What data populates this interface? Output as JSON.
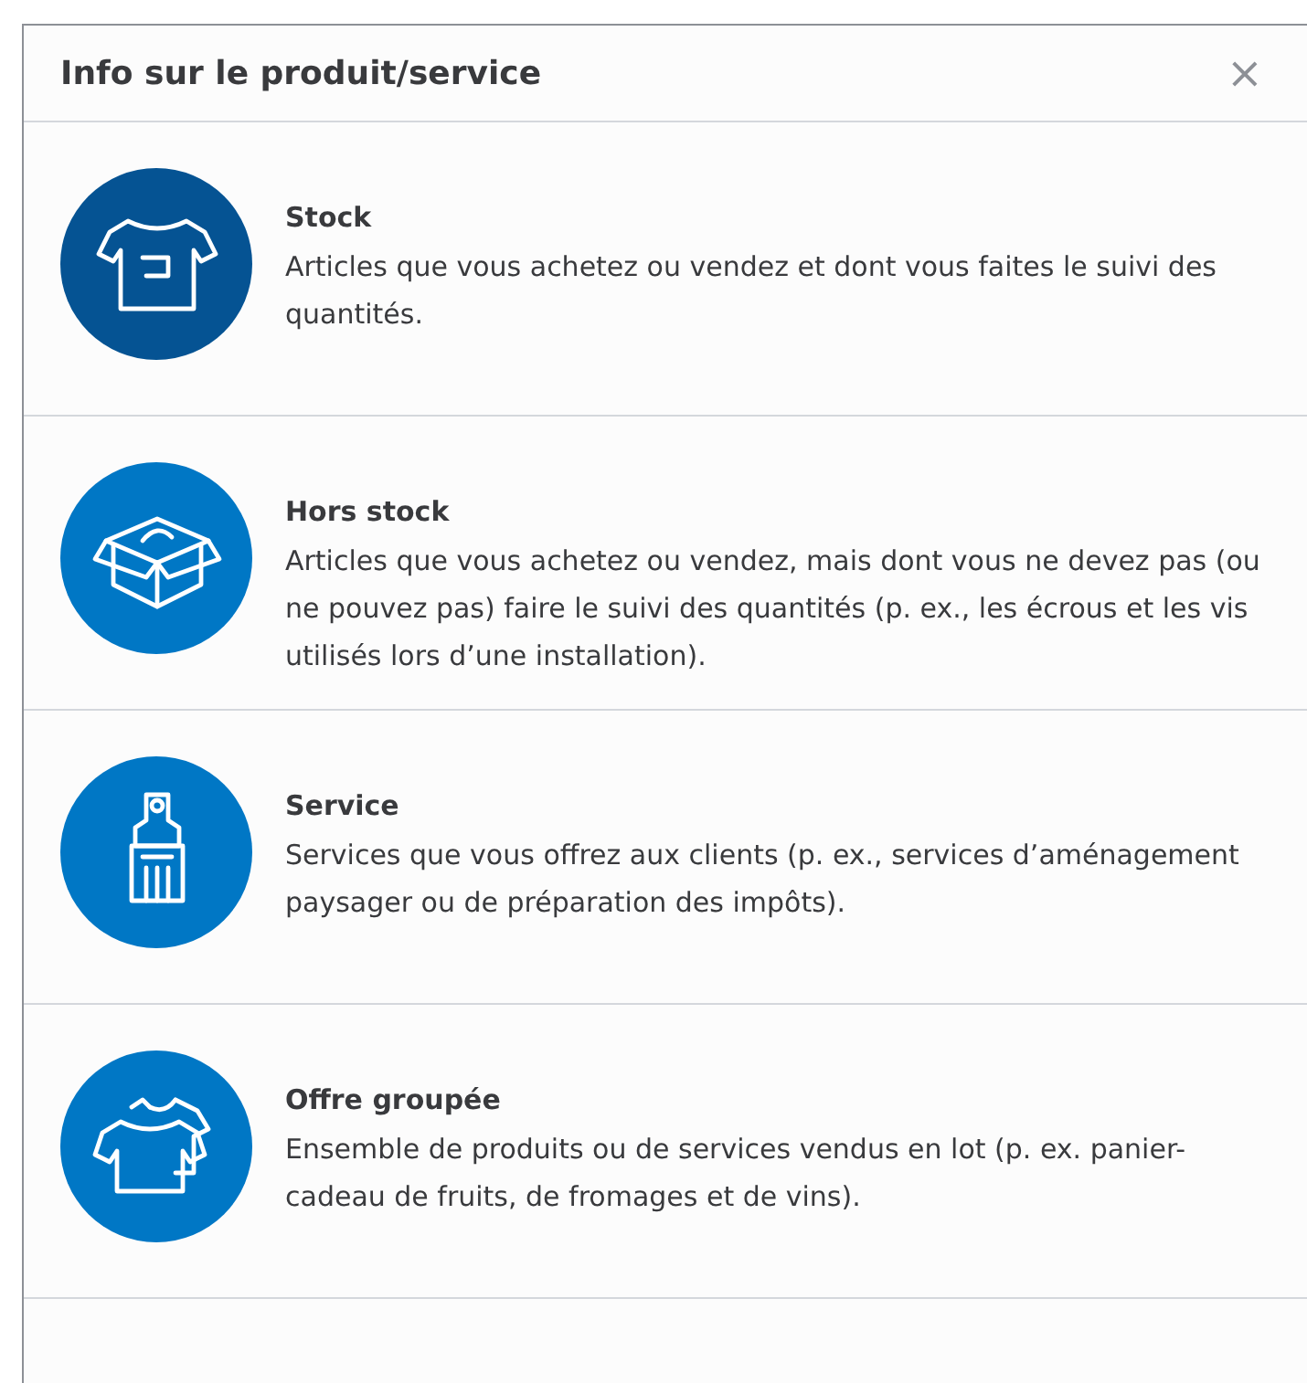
{
  "dialog": {
    "title": "Info sur le produit/service",
    "close": "×"
  },
  "options": [
    {
      "kind": "shirt",
      "selected": true,
      "title": "Stock",
      "description": "Articles que vous achetez ou vendez et dont vous faites le suivi des quantités."
    },
    {
      "kind": "box",
      "selected": false,
      "title": "Hors stock",
      "description": "Articles que vous achetez ou vendez, mais dont vous ne devez pas (ou ne pouvez pas) faire le suivi des quantités (p. ex., les écrous et les vis utilisés lors d’une installation)."
    },
    {
      "kind": "brush",
      "selected": false,
      "title": "Service",
      "description": "Services que vous offrez aux clients (p. ex., services d’aménagement paysager ou de préparation des impôts)."
    },
    {
      "kind": "shirts",
      "selected": false,
      "title": "Offre groupée",
      "description": "Ensemble de produits ou de services vendus en lot (p. ex. panier-cadeau de fruits, de fromages et de vins)."
    }
  ]
}
